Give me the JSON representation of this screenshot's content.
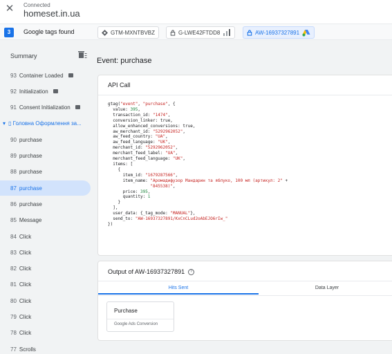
{
  "header": {
    "status": "Connected",
    "domain": "homeset.in.ua"
  },
  "tags": {
    "count": "3",
    "found_label": "Google tags found",
    "chips": [
      {
        "label": "GTM-MXNTBVBZ"
      },
      {
        "label": "G-LWE42FTDD8"
      },
      {
        "label": "AW-16937327891"
      }
    ]
  },
  "sidebar": {
    "summary": "Summary",
    "items": [
      {
        "num": "93",
        "label": "Container Loaded"
      },
      {
        "num": "92",
        "label": "Initialization"
      },
      {
        "num": "91",
        "label": "Consent Initialization"
      },
      {
        "num": "",
        "label": "▯ Головна Оформлення за..."
      },
      {
        "num": "90",
        "label": "purchase"
      },
      {
        "num": "89",
        "label": "purchase"
      },
      {
        "num": "88",
        "label": "purchase"
      },
      {
        "num": "87",
        "label": "purchase"
      },
      {
        "num": "86",
        "label": "purchase"
      },
      {
        "num": "85",
        "label": "Message"
      },
      {
        "num": "84",
        "label": "Click"
      },
      {
        "num": "83",
        "label": "Click"
      },
      {
        "num": "82",
        "label": "Click"
      },
      {
        "num": "81",
        "label": "Click"
      },
      {
        "num": "80",
        "label": "Click"
      },
      {
        "num": "79",
        "label": "Click"
      },
      {
        "num": "78",
        "label": "Click"
      },
      {
        "num": "77",
        "label": "Scrolls"
      }
    ]
  },
  "main": {
    "event_title": "Event: purchase",
    "api_card_title": "API Call",
    "output_title": "Output of AW-16937327891",
    "tabs": {
      "hits": "Hits Sent",
      "layer": "Data Layer"
    },
    "hit": {
      "name": "Purchase",
      "type": "Google Ads Conversion"
    }
  },
  "code_lines": [
    "gtag(\"event\", \"purchase\", {",
    "  value: 395,",
    "  transaction_id: \"1474\",",
    "  conversion_linker: true,",
    "  allow_enhanced_conversions: true,",
    "  aw_merchant_id: \"5292962052\",",
    "  aw_feed_country: \"UA\",",
    "  aw_feed_language: \"UK\",",
    "  merchant_id: \"5292962052\",",
    "  merchant_feed_label: \"UA\",",
    "  merchant_feed_language: \"UK\",",
    "  items: [",
    "    {",
    "      item_id: \"1679287566\",",
    "      item_name: \"Аромадифузор Мандарин та яблуко, 100 мл (артикул: 2\" +",
    "                 \"845538)\",",
    "      price: 395,",
    "      quantity: 1",
    "    }",
    "  ],",
    "  user_data: {_tag_mode: \"MANUAL\"},",
    "  send_to: \"AW-16937327891/KxCnCLud2oAbEJO6rIw_\"",
    "})"
  ]
}
